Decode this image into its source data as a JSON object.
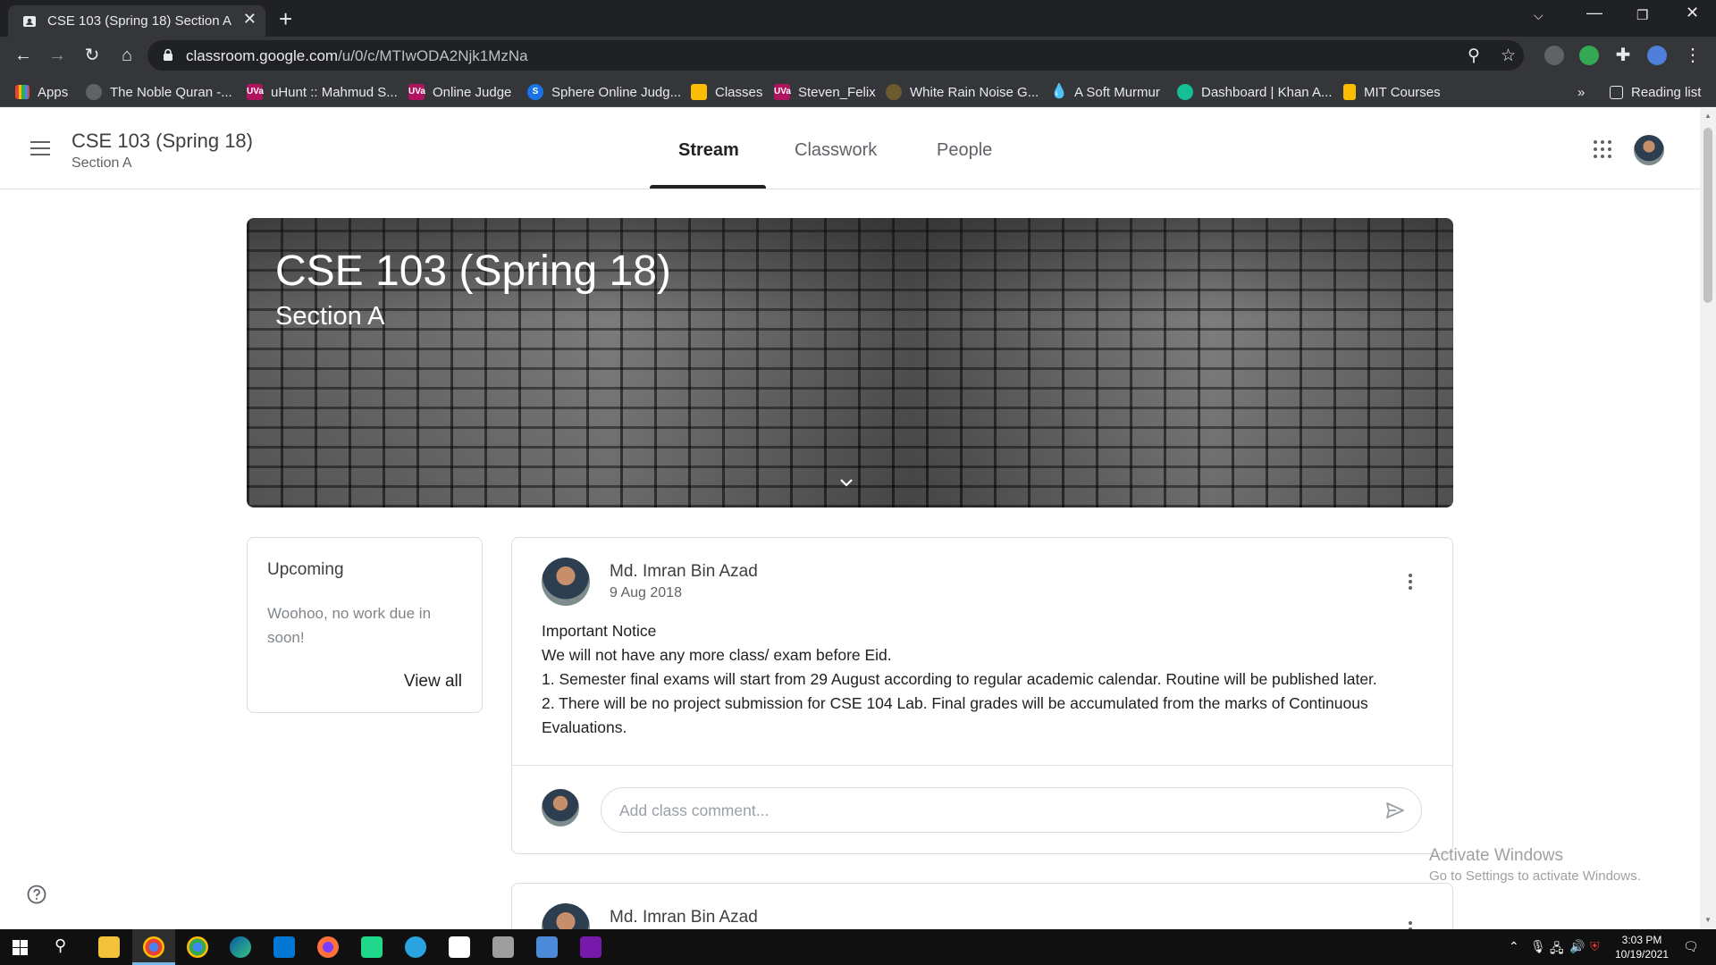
{
  "browser": {
    "tab_title": "CSE 103 (Spring 18) Section A",
    "url_host": "classroom.google.com",
    "url_path": "/u/0/c/MTIwODA2Njk1MzNa",
    "bookmarks": [
      "Apps",
      "The Noble Quran -...",
      "uHunt :: Mahmud S...",
      "Online Judge",
      "Sphere Online Judg...",
      "Classes",
      "Steven_Felix",
      "White Rain Noise G...",
      "A Soft Murmur",
      "Dashboard | Khan A...",
      "MIT Courses"
    ],
    "bookmark_overflow": "»",
    "reading_list": "Reading list",
    "colors": {
      "frame": "#202124",
      "toolbar": "#35363a"
    }
  },
  "header": {
    "course_title": "CSE 103 (Spring 18)",
    "section": "Section A",
    "tabs": [
      "Stream",
      "Classwork",
      "People"
    ],
    "active_tab": "Stream"
  },
  "banner": {
    "title": "CSE 103 (Spring 18)",
    "subtitle": "Section A"
  },
  "upcoming": {
    "title": "Upcoming",
    "message": "Woohoo, no work due in soon!",
    "link": "View all"
  },
  "post": {
    "author": "Md. Imran Bin Azad",
    "date": "9 Aug 2018",
    "lines": [
      "Important Notice",
      "We will not have any more class/ exam before Eid.",
      "1. Semester final exams will start from 29 August according to regular academic calendar. Routine will be published later.",
      "2. There will be no project submission for CSE 104 Lab. Final grades will be accumulated from the marks of Continuous Evaluations."
    ],
    "comment_placeholder": "Add class comment..."
  },
  "post2": {
    "author": "Md. Imran Bin Azad"
  },
  "watermark": {
    "title": "Activate Windows",
    "subtitle": "Go to Settings to activate Windows."
  },
  "taskbar": {
    "time": "3:03 PM",
    "date": "10/19/2021"
  }
}
